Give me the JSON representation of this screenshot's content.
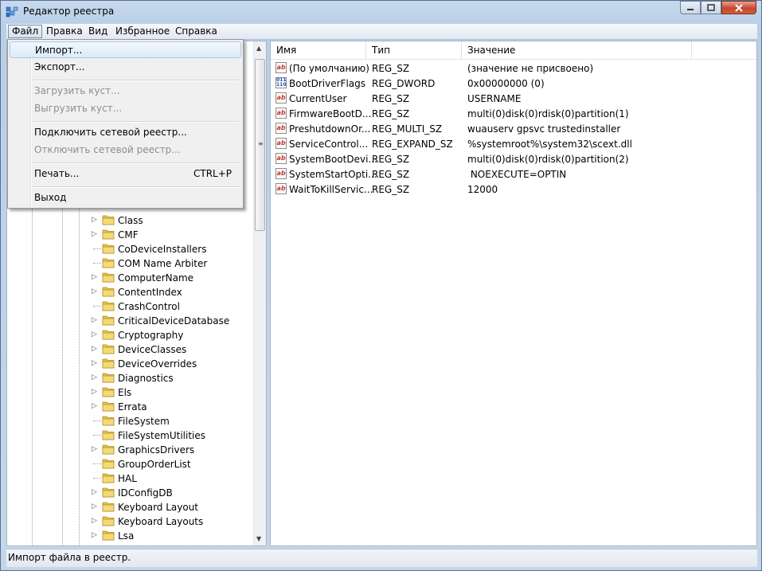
{
  "window": {
    "title": "Редактор реестра"
  },
  "menubar": [
    {
      "label": "Файл",
      "active": true
    },
    {
      "label": "Правка"
    },
    {
      "label": "Вид"
    },
    {
      "label": "Избранное"
    },
    {
      "label": "Справка"
    }
  ],
  "file_menu": {
    "items": [
      {
        "label": "Импорт...",
        "state": "highlighted"
      },
      {
        "label": "Экспорт..."
      },
      {
        "label": "Загрузить куст...",
        "state": "disabled"
      },
      {
        "label": "Выгрузить куст...",
        "state": "disabled"
      },
      {
        "label": "Подключить сетевой реестр..."
      },
      {
        "label": "Отключить сетевой реестр...",
        "state": "disabled"
      },
      {
        "label": "Печать...",
        "shortcut": "CTRL+P"
      },
      {
        "label": "Выход"
      }
    ]
  },
  "tree": {
    "items": [
      {
        "label": "Class",
        "expandable": true
      },
      {
        "label": "CMF",
        "expandable": true
      },
      {
        "label": "CoDeviceInstallers",
        "expandable": false
      },
      {
        "label": "COM Name Arbiter",
        "expandable": false
      },
      {
        "label": "ComputerName",
        "expandable": true
      },
      {
        "label": "ContentIndex",
        "expandable": true
      },
      {
        "label": "CrashControl",
        "expandable": false
      },
      {
        "label": "CriticalDeviceDatabase",
        "expandable": true
      },
      {
        "label": "Cryptography",
        "expandable": true
      },
      {
        "label": "DeviceClasses",
        "expandable": true
      },
      {
        "label": "DeviceOverrides",
        "expandable": true
      },
      {
        "label": "Diagnostics",
        "expandable": true
      },
      {
        "label": "Els",
        "expandable": true
      },
      {
        "label": "Errata",
        "expandable": true
      },
      {
        "label": "FileSystem",
        "expandable": false
      },
      {
        "label": "FileSystemUtilities",
        "expandable": false
      },
      {
        "label": "GraphicsDrivers",
        "expandable": true
      },
      {
        "label": "GroupOrderList",
        "expandable": false
      },
      {
        "label": "HAL",
        "expandable": false
      },
      {
        "label": "IDConfigDB",
        "expandable": true
      },
      {
        "label": "Keyboard Layout",
        "expandable": true
      },
      {
        "label": "Keyboard Layouts",
        "expandable": true
      },
      {
        "label": "Lsa",
        "expandable": true
      }
    ]
  },
  "values_table": {
    "columns": [
      "Имя",
      "Тип",
      "Значение"
    ],
    "rows": [
      {
        "icon": "string-value-icon",
        "name": "(По умолчанию)",
        "type": "REG_SZ",
        "data": "(значение не присвоено)"
      },
      {
        "icon": "binary-value-icon",
        "name": "BootDriverFlags",
        "type": "REG_DWORD",
        "data": "0x00000000 (0)"
      },
      {
        "icon": "string-value-icon",
        "name": "CurrentUser",
        "type": "REG_SZ",
        "data": "USERNAME"
      },
      {
        "icon": "string-value-icon",
        "name": "FirmwareBootD...",
        "type": "REG_SZ",
        "data": "multi(0)disk(0)rdisk(0)partition(1)"
      },
      {
        "icon": "string-value-icon",
        "name": "PreshutdownOr...",
        "type": "REG_MULTI_SZ",
        "data": "wuauserv gpsvc trustedinstaller"
      },
      {
        "icon": "string-value-icon",
        "name": "ServiceControl...",
        "type": "REG_EXPAND_SZ",
        "data": "%systemroot%\\system32\\scext.dll"
      },
      {
        "icon": "string-value-icon",
        "name": "SystemBootDevi...",
        "type": "REG_SZ",
        "data": "multi(0)disk(0)rdisk(0)partition(2)"
      },
      {
        "icon": "string-value-icon",
        "name": "SystemStartOpti...",
        "type": "REG_SZ",
        "data": " NOEXECUTE=OPTIN"
      },
      {
        "icon": "string-value-icon",
        "name": "WaitToKillServic...",
        "type": "REG_SZ",
        "data": "12000"
      }
    ]
  },
  "statusbar": {
    "text": "Импорт файла в реестр."
  },
  "colors": {
    "folder": "#e8c34a",
    "menu_highlight": "#dcebf9",
    "close_button": "#c8462f"
  }
}
